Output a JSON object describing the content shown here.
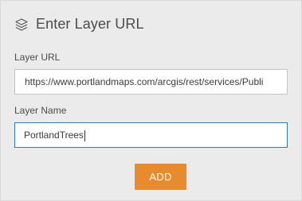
{
  "header": {
    "icon": "layers-icon",
    "title": "Enter Layer URL"
  },
  "form": {
    "layer_url": {
      "label": "Layer URL",
      "value": "https://www.portlandmaps.com/arcgis/rest/services/Publi"
    },
    "layer_name": {
      "label": "Layer Name",
      "value": "PortlandTrees"
    },
    "add_button_label": "ADD"
  },
  "colors": {
    "accent": "#e88b2e",
    "focus_border": "#2f7ab5",
    "background": "#ebebeb"
  }
}
